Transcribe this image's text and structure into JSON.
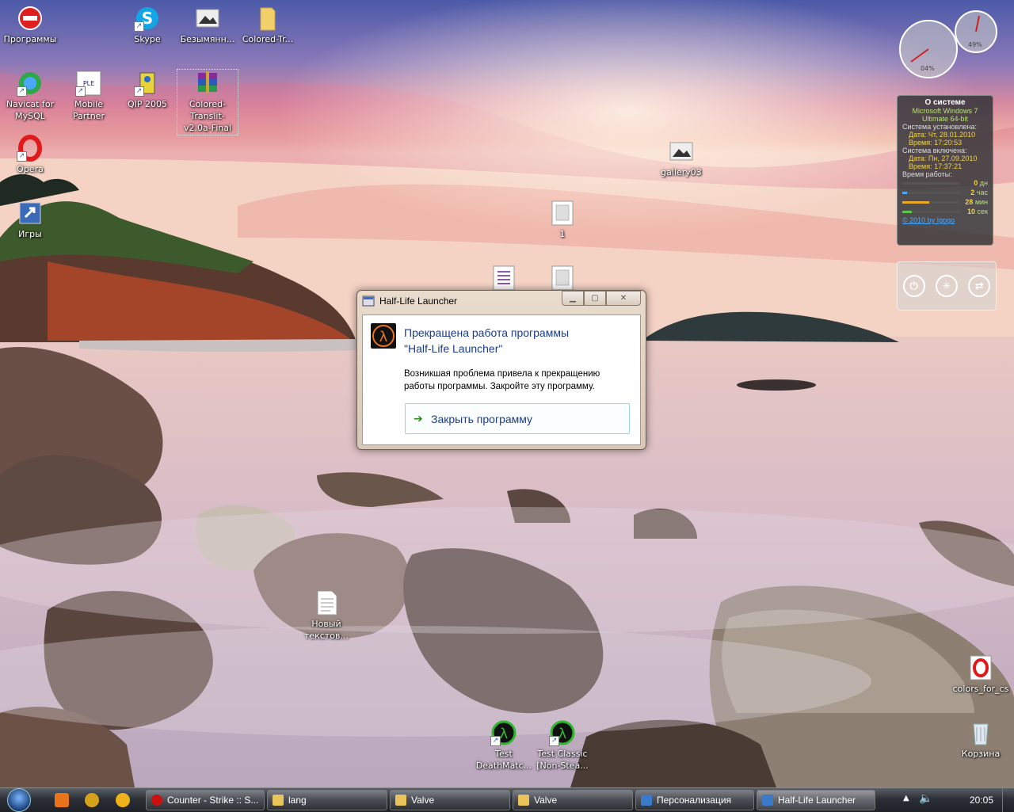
{
  "desktop": {
    "icons": [
      {
        "label": "Программы"
      },
      {
        "label": "Skype"
      },
      {
        "label": "Безымянн..."
      },
      {
        "label": "Colored-Tr..."
      },
      {
        "label": "Navicat for MySQL"
      },
      {
        "label": "Mobile Partner"
      },
      {
        "label": "QIP 2005"
      },
      {
        "label": "Colored-Translit-v2.0a-Final"
      },
      {
        "label": "Opera"
      },
      {
        "label": "Игры"
      },
      {
        "label": "gallery03"
      },
      {
        "label": "1"
      },
      {
        "label": "Новый текстов..."
      },
      {
        "label": "Test DeathMatc..."
      },
      {
        "label": "Test Classic [Non-Stea..."
      },
      {
        "label": "colors_for_cs"
      },
      {
        "label": "Корзина"
      }
    ]
  },
  "gauges": {
    "cpu": "04%",
    "mem": "49%"
  },
  "sysinfo": {
    "title": "О системе",
    "os1": "Microsoft Windows 7",
    "os2": "Ultimate 64-bit",
    "installed_label": "Система установлена:",
    "installed_date": "Дата: Чт, 28.01.2010",
    "installed_time": "Время: 17:20:53",
    "boot_label": "Система включена:",
    "boot_date": "Дата: Пн, 27.09.2010",
    "boot_time": "Время: 17:37:21",
    "uptime_label": "Время работы:",
    "uptime": [
      {
        "value": "0",
        "unit": "дн",
        "fill": 0
      },
      {
        "value": "2",
        "unit": "час",
        "fill": 0.08
      },
      {
        "value": "28",
        "unit": "мин",
        "fill": 0.47
      },
      {
        "value": "10",
        "unit": "сек",
        "fill": 0.17
      }
    ],
    "credit": "© 2010 by Igogo"
  },
  "dialog": {
    "window_title": "Half-Life Launcher",
    "heading_line1": "Прекращена работа программы",
    "heading_line2": "\"Half-Life Launcher\"",
    "message": "Возникшая проблема привела к прекращению работы программы. Закройте эту программу.",
    "close_program": "Закрыть программу"
  },
  "taskbar": {
    "buttons": [
      {
        "label": "Counter - Strike :: S...",
        "icon_color": "#cc1010"
      },
      {
        "label": "lang",
        "icon_color": "#e8c45a"
      },
      {
        "label": "Valve",
        "icon_color": "#e8c45a"
      },
      {
        "label": "Valve",
        "icon_color": "#e8c45a"
      },
      {
        "label": "Персонализация",
        "icon_color": "#3a7ac8"
      },
      {
        "label": "Half-Life Launcher",
        "icon_color": "#3a7ac8"
      }
    ],
    "clock": "20:05"
  }
}
